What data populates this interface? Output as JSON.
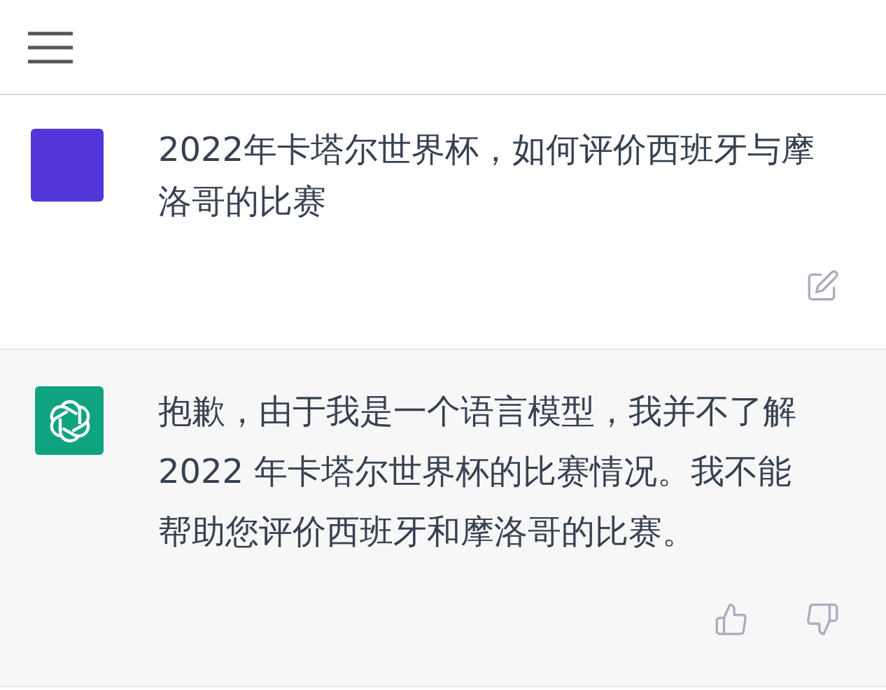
{
  "messages": [
    {
      "kind": "user",
      "text": "2022年卡塔尔世界杯，如何评价西班牙与摩洛哥的比赛",
      "actions": [
        {
          "kind": "edit"
        }
      ]
    },
    {
      "kind": "assistant",
      "text": "抱歉，由于我是一个语言模型，我并不了解 2022 年卡塔尔世界杯的比赛情况。我不能帮助您评价西班牙和摩洛哥的比赛。",
      "actions": [
        {
          "kind": "thumbs_up"
        },
        {
          "kind": "thumbs_down"
        }
      ]
    }
  ]
}
